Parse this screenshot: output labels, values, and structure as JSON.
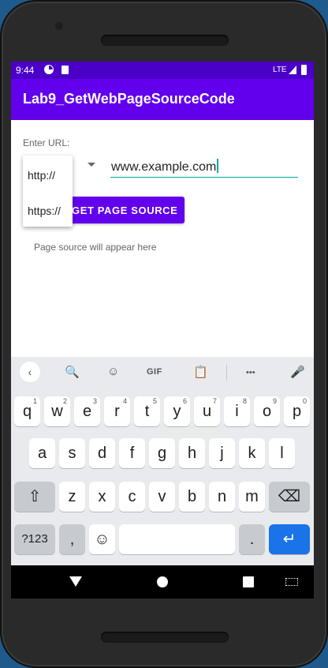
{
  "status_bar": {
    "time": "9:44",
    "network": "LTE"
  },
  "app_bar": {
    "title": "Lab9_GetWebPageSourceCode"
  },
  "form": {
    "url_label": "Enter URL:",
    "url_value": "www.example.com",
    "protocol_options": [
      "http://",
      "https://"
    ],
    "button_label": "GET PAGE SOURCE",
    "result_text": "Page source will appear here"
  },
  "keyboard": {
    "toolbar": {
      "back": "‹",
      "search": "🔍",
      "sticker": "☺",
      "gif": "GIF",
      "clipboard": "📋",
      "more": "•••",
      "mic": "🎤"
    },
    "row1": [
      {
        "key": "q",
        "hint": "1"
      },
      {
        "key": "w",
        "hint": "2"
      },
      {
        "key": "e",
        "hint": "3"
      },
      {
        "key": "r",
        "hint": "4"
      },
      {
        "key": "t",
        "hint": "5"
      },
      {
        "key": "y",
        "hint": "6"
      },
      {
        "key": "u",
        "hint": "7"
      },
      {
        "key": "i",
        "hint": "8"
      },
      {
        "key": "o",
        "hint": "9"
      },
      {
        "key": "p",
        "hint": "0"
      }
    ],
    "row2": [
      "a",
      "s",
      "d",
      "f",
      "g",
      "h",
      "j",
      "k",
      "l"
    ],
    "row3": [
      "z",
      "x",
      "c",
      "v",
      "b",
      "n",
      "m"
    ],
    "shift": "⇧",
    "backspace": "⌫",
    "symbols": "?123",
    "comma": ",",
    "emoji": "☺",
    "period": ".",
    "enter": "↵"
  },
  "colors": {
    "status_bar": "#4b00c8",
    "app_bar": "#6200ee",
    "accent": "#03a9a0",
    "enter_key": "#1a73e8"
  }
}
